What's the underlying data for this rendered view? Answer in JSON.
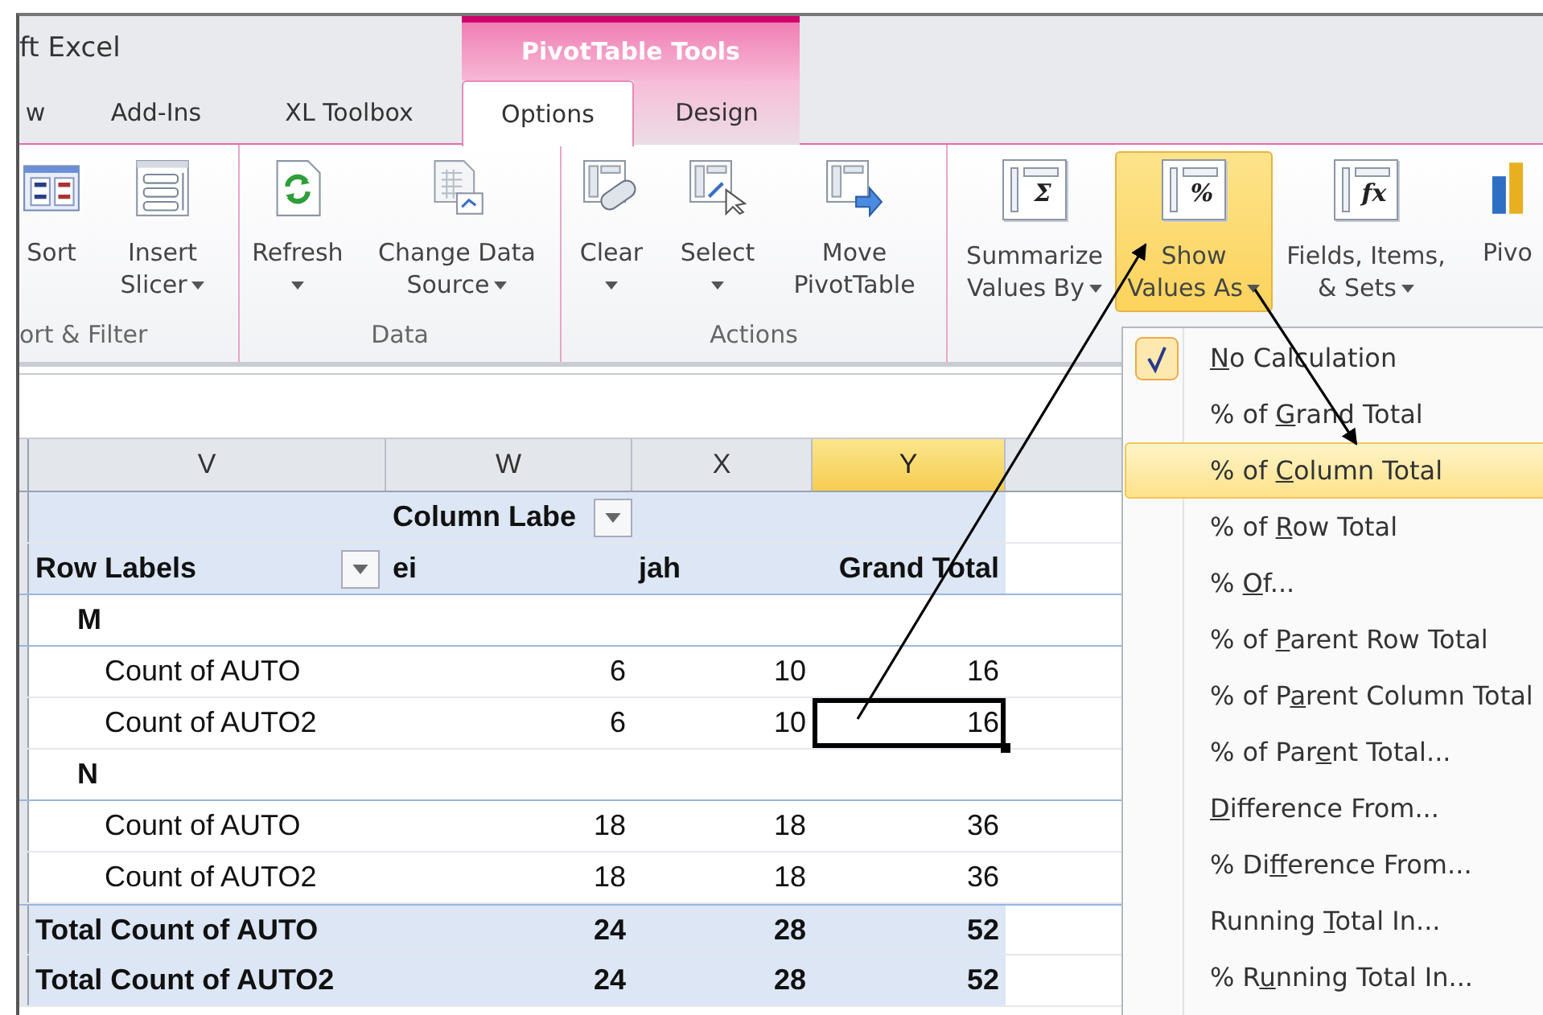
{
  "title": "ft Excel",
  "context_tab": "PivotTable Tools",
  "tabs": [
    {
      "label": "w",
      "selected": false
    },
    {
      "label": "Add-Ins",
      "selected": false
    },
    {
      "label": "XL Toolbox",
      "selected": false
    },
    {
      "label": "Options",
      "selected": true
    },
    {
      "label": "Design",
      "selected": false
    }
  ],
  "ribbon_groups": [
    {
      "label": "ort & Filter",
      "buttons": [
        {
          "lines": [
            "Sort"
          ],
          "dropdown": false,
          "highlighted": false
        },
        {
          "lines": [
            "Insert",
            "Slicer"
          ],
          "dropdown": true,
          "highlighted": false
        }
      ]
    },
    {
      "label": "Data",
      "buttons": [
        {
          "lines": [
            "Refresh"
          ],
          "dropdown": true,
          "highlighted": false
        },
        {
          "lines": [
            "Change Data",
            "Source"
          ],
          "dropdown": true,
          "highlighted": false
        }
      ]
    },
    {
      "label": "Actions",
      "buttons": [
        {
          "lines": [
            "Clear"
          ],
          "dropdown": true,
          "highlighted": false
        },
        {
          "lines": [
            "Select"
          ],
          "dropdown": true,
          "highlighted": false
        },
        {
          "lines": [
            "Move",
            "PivotTable"
          ],
          "dropdown": false,
          "highlighted": false
        }
      ]
    },
    {
      "buttons": [
        {
          "glyph": "Σ",
          "lines": [
            "Summarize",
            "Values By"
          ],
          "dropdown": true,
          "highlighted": false
        },
        {
          "glyph": "%",
          "lines": [
            "Show",
            "Values As"
          ],
          "dropdown": true,
          "highlighted": true
        },
        {
          "glyph": "fx",
          "lines": [
            "Fields, Items,",
            "& Sets"
          ],
          "dropdown": true,
          "highlighted": false
        },
        {
          "lines": [
            "Pivo"
          ],
          "dropdown": false,
          "highlighted": false
        }
      ]
    }
  ],
  "columns": [
    {
      "letter": "V",
      "selected": false
    },
    {
      "letter": "W",
      "selected": false
    },
    {
      "letter": "X",
      "selected": false
    },
    {
      "letter": "Y",
      "selected": true
    }
  ],
  "pivot": {
    "column_labels": "Column Labe",
    "row_labels": "Row Labels",
    "headers": [
      "ei",
      "jah",
      "Grand Total"
    ],
    "rows": [
      {
        "kind": "group",
        "label": "M"
      },
      {
        "kind": "item",
        "label": "Count of AUTO",
        "cells": [
          {
            "text": "6",
            "selected": false
          },
          {
            "text": "10",
            "selected": false
          },
          {
            "text": "16",
            "selected": false
          }
        ]
      },
      {
        "kind": "item",
        "label": "Count of AUTO2",
        "cells": [
          {
            "text": "6",
            "selected": false
          },
          {
            "text": "10",
            "selected": false
          },
          {
            "text": "16",
            "selected": true
          }
        ]
      },
      {
        "kind": "group",
        "label": "N"
      },
      {
        "kind": "item",
        "label": "Count of AUTO",
        "cells": [
          {
            "text": "18",
            "selected": false
          },
          {
            "text": "18",
            "selected": false
          },
          {
            "text": "36",
            "selected": false
          }
        ]
      },
      {
        "kind": "item",
        "label": "Count of AUTO2",
        "cells": [
          {
            "text": "18",
            "selected": false
          },
          {
            "text": "18",
            "selected": false
          },
          {
            "text": "36",
            "selected": false
          }
        ]
      },
      {
        "kind": "total",
        "label": "Total Count of AUTO",
        "cells": [
          {
            "text": "24",
            "selected": false
          },
          {
            "text": "28",
            "selected": false
          },
          {
            "text": "52",
            "selected": false
          }
        ]
      },
      {
        "kind": "total",
        "label": "Total Count of AUTO2",
        "cells": [
          {
            "text": "24",
            "selected": false
          },
          {
            "text": "28",
            "selected": false
          },
          {
            "text": "52",
            "selected": false
          }
        ]
      }
    ]
  },
  "menu": {
    "items": [
      {
        "accel": "N",
        "after": "o Calculation",
        "checked": true,
        "selected": false
      },
      {
        "before": "% of ",
        "accel": "G",
        "after": "rand Total",
        "checked": false,
        "selected": false
      },
      {
        "before": "% of ",
        "accel": "C",
        "after": "olumn Total",
        "checked": false,
        "selected": true
      },
      {
        "before": "% of ",
        "accel": "R",
        "after": "ow Total",
        "checked": false,
        "selected": false
      },
      {
        "before": "% ",
        "accel": "O",
        "after": "f...",
        "checked": false,
        "selected": false
      },
      {
        "before": "% of ",
        "accel": "P",
        "after": "arent Row Total",
        "checked": false,
        "selected": false
      },
      {
        "before": "% of P",
        "accel": "a",
        "after": "rent Column Total",
        "checked": false,
        "selected": false
      },
      {
        "before": "% of Par",
        "accel": "e",
        "after": "nt Total...",
        "checked": false,
        "selected": false
      },
      {
        "accel": "D",
        "after": "ifference From...",
        "checked": false,
        "selected": false
      },
      {
        "before": "% Di",
        "accel": "f",
        "after": "ference From...",
        "checked": false,
        "selected": false
      },
      {
        "before": "Running ",
        "accel": "T",
        "after": "otal In...",
        "checked": false,
        "selected": false
      },
      {
        "before": "% R",
        "accel": "u",
        "after": "nning Total In...",
        "checked": false,
        "selected": false
      }
    ]
  }
}
